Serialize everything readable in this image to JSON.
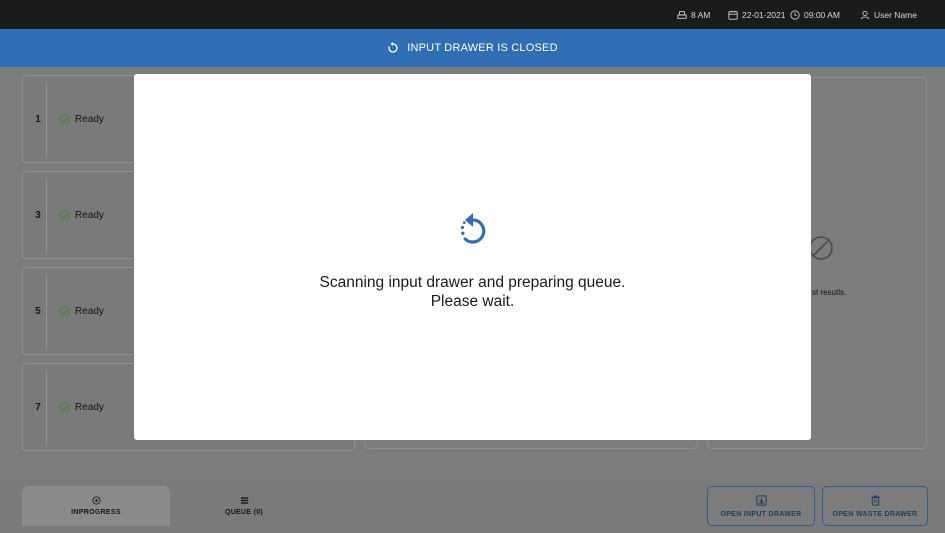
{
  "topbar": {
    "indicator_label": "8 AM",
    "date": "22-01-2021",
    "time": "09:00 AM",
    "user": "User Name",
    "icons": [
      "printer-icon",
      "calendar-icon",
      "clock-icon",
      "user-icon"
    ]
  },
  "banner": {
    "icon": "refresh-icon",
    "text": "INPUT DRAWER IS CLOSED"
  },
  "slots": [
    {
      "number": "1",
      "status": "Ready"
    },
    {
      "number": "3",
      "status": "Ready"
    },
    {
      "number": "5",
      "status": "Ready"
    },
    {
      "number": "7",
      "status": "Ready"
    }
  ],
  "results_panel": {
    "empty_text_visible": "st resutls.",
    "icon": "no-results-icon"
  },
  "bottom_nav": {
    "inprogress_label": "INPROGRESS",
    "queue_label": "QUEUE (0)",
    "open_input_label": "OPEN INPUT DRAWER",
    "open_waste_label": "OPEN WASTE DRAWER"
  },
  "modal": {
    "message_line1": "Scanning input drawer and preparing queue.",
    "message_line2": "Please wait.",
    "icon": "loading-icon"
  },
  "colors": {
    "banner": "#2f6eb5",
    "ready": "#2e8b3a",
    "spinner": "#2f6eb5",
    "topbar": "#1b1b1b"
  }
}
